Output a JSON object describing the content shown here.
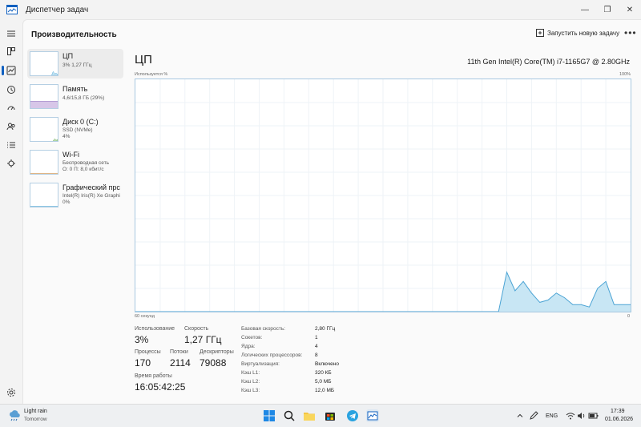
{
  "window": {
    "title": "Диспетчер задач"
  },
  "rail": {
    "icons": [
      "hamburger-icon",
      "processes-icon",
      "performance-icon",
      "app-history-icon",
      "startup-icon",
      "users-icon",
      "details-icon",
      "services-icon",
      "settings-icon"
    ]
  },
  "header": {
    "title": "Производительность",
    "run_task_label": "Запустить новую задачу",
    "more": "•••"
  },
  "sidebar": {
    "items": [
      {
        "name": "ЦП",
        "line1": "3%  1,27 ГГц",
        "line2": ""
      },
      {
        "name": "Память",
        "line1": "4,6/15,8 ГБ (29%)",
        "line2": ""
      },
      {
        "name": "Диск 0 (C:)",
        "line1": "SSD (NVMe)",
        "line2": "4%"
      },
      {
        "name": "Wi-Fi",
        "line1": "Беспроводная сеть",
        "line2": "О: 0  П: 8,0 кбит/с"
      },
      {
        "name": "Графический прс",
        "line1": "Intel(R) Iris(R) Xe Graphi",
        "line2": "0%"
      }
    ]
  },
  "detail": {
    "title": "ЦП",
    "model": "11th Gen Intel(R) Core(TM) i7-1165G7 @ 2.80GHz",
    "graph_top_left": "Используется %",
    "graph_top_right": "100%",
    "graph_bottom_left": "60 секунд",
    "graph_bottom_right": "0"
  },
  "stats": {
    "usage_label": "Использование",
    "usage_value": "3%",
    "speed_label": "Скорость",
    "speed_value": "1,27 ГГц",
    "processes_label": "Процессы",
    "processes_value": "170",
    "threads_label": "Потоки",
    "threads_value": "2114",
    "handles_label": "Дескрипторы",
    "handles_value": "79088",
    "uptime_label": "Время работы",
    "uptime_value": "16:05:42:25"
  },
  "specs": [
    {
      "label": "Базовая скорость:",
      "value": "2,80 ГГц"
    },
    {
      "label": "Сокетов:",
      "value": "1"
    },
    {
      "label": "Ядра:",
      "value": "4"
    },
    {
      "label": "Логических процессоров:",
      "value": "8"
    },
    {
      "label": "Виртуализация:",
      "value": "Включено"
    },
    {
      "label": "Кэш L1:",
      "value": "320 КБ"
    },
    {
      "label": "Кэш L2:",
      "value": "5,0 МБ"
    },
    {
      "label": "Кэш L3:",
      "value": "12,0 МБ"
    }
  ],
  "chart_data": {
    "type": "area",
    "xlim": [
      60,
      0
    ],
    "ylim": [
      0,
      100
    ],
    "x": [
      60,
      59,
      58,
      57,
      56,
      55,
      54,
      53,
      52,
      51,
      50,
      49,
      48,
      47,
      46,
      45,
      44,
      43,
      42,
      41,
      40,
      39,
      38,
      37,
      36,
      35,
      34,
      33,
      32,
      31,
      30,
      29,
      28,
      27,
      26,
      25,
      24,
      23,
      22,
      21,
      20,
      19,
      18,
      17,
      16,
      15,
      14,
      13,
      12,
      11,
      10,
      9,
      8,
      7,
      6,
      5,
      4,
      3,
      2,
      1,
      0
    ],
    "values": [
      0,
      0,
      0,
      0,
      0,
      0,
      0,
      0,
      0,
      0,
      0,
      0,
      0,
      0,
      0,
      0,
      0,
      0,
      0,
      0,
      0,
      0,
      0,
      0,
      0,
      0,
      0,
      0,
      0,
      0,
      0,
      0,
      0,
      0,
      0,
      0,
      0,
      0,
      0,
      0,
      0,
      0,
      0,
      0,
      0,
      17,
      9,
      13,
      8,
      4,
      5,
      8,
      6,
      3,
      3,
      2,
      10,
      13,
      3,
      3,
      3
    ]
  },
  "taskbar": {
    "weather_main": "Light rain",
    "weather_sub": "Tomorrow",
    "lang": "ENG",
    "time": "17:39",
    "date": "01.06.2026"
  },
  "colors": {
    "accent": "#1060c0",
    "graph_border": "#a8c8e0",
    "graph_fill": "#c8e6f4",
    "graph_line": "#4aa3d4"
  }
}
